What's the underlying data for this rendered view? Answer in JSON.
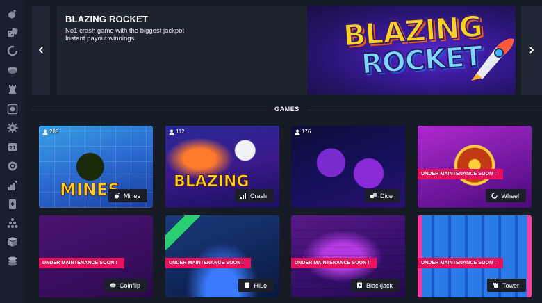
{
  "sidebar": {
    "icons": [
      "bomb-icon",
      "dice-icon",
      "crash-icon",
      "coinflip-icon",
      "tower-icon",
      "roulette-icon",
      "wheel-icon",
      "cards-icon",
      "chip-icon",
      "chart-icon",
      "blackjack-icon",
      "plinko-icon",
      "cases-icon",
      "coins-icon"
    ]
  },
  "banner": {
    "title": "BLAZING ROCKET",
    "line1": "No1 crash game with the biggest jackpot",
    "line2": "Instant payout winnings",
    "art_top": "BLAZING",
    "art_bottom": "ROCKET"
  },
  "section": {
    "title": "GAMES"
  },
  "games": [
    {
      "name": "Mines",
      "players": "285",
      "maintenance": "",
      "art": "MINES"
    },
    {
      "name": "Crash",
      "players": "112",
      "maintenance": "",
      "art": "BLAZING"
    },
    {
      "name": "Dice",
      "players": "176",
      "maintenance": "",
      "art": ""
    },
    {
      "name": "Wheel",
      "players": "",
      "maintenance": "UNDER MAINTENANCE SOON !",
      "art": ""
    },
    {
      "name": "Coinflip",
      "players": "",
      "maintenance": "UNDER MAINTENANCE SOON !",
      "art": ""
    },
    {
      "name": "HiLo",
      "players": "",
      "maintenance": "UNDER MAINTENANCE SOON !",
      "art": ""
    },
    {
      "name": "Blackjack",
      "players": "",
      "maintenance": "UNDER MAINTENANCE SOON !",
      "art": ""
    },
    {
      "name": "Tower",
      "players": "",
      "maintenance": "UNDER MAINTENANCE SOON !",
      "art": ""
    }
  ],
  "colors": {
    "accent": "#e8105a",
    "bg": "#171b26",
    "panel": "#20242f"
  }
}
